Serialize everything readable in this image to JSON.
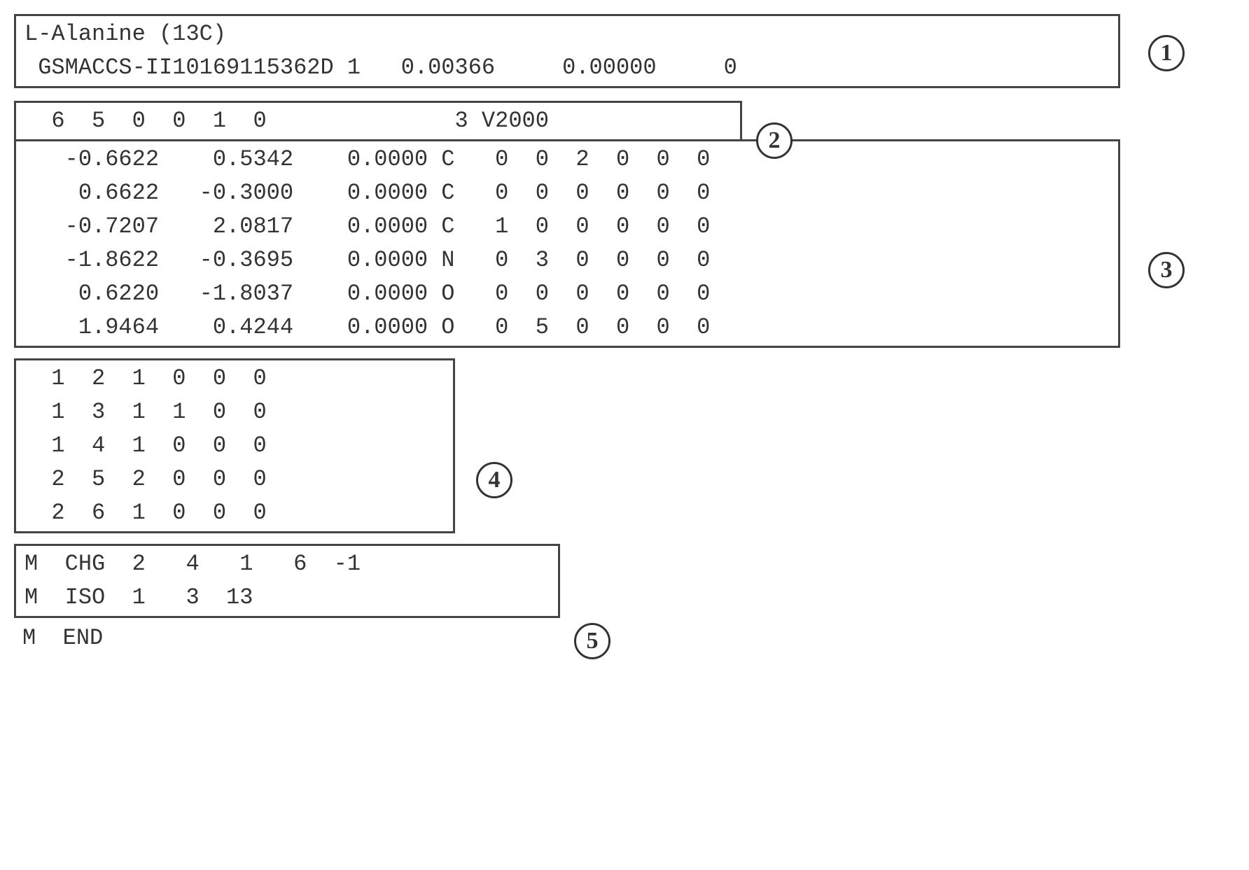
{
  "header": {
    "line1": "L-Alanine (13C)",
    "line2": " GSMACCS-II10169115362D 1   0.00366     0.00000     0"
  },
  "counts_line": "  6  5  0  0  1  0              3 V2000",
  "atoms": [
    "   -0.6622    0.5342    0.0000 C   0  0  2  0  0  0",
    "    0.6622   -0.3000    0.0000 C   0  0  0  0  0  0",
    "   -0.7207    2.0817    0.0000 C   1  0  0  0  0  0",
    "   -1.8622   -0.3695    0.0000 N   0  3  0  0  0  0",
    "    0.6220   -1.8037    0.0000 O   0  0  0  0  0  0",
    "    1.9464    0.4244    0.0000 O   0  5  0  0  0  0"
  ],
  "bonds": [
    "  1  2  1  0  0  0",
    "  1  3  1  1  0  0",
    "  1  4  1  0  0  0",
    "  2  5  2  0  0  0",
    "  2  6  1  0  0  0"
  ],
  "props": [
    "M  CHG  2   4   1   6  -1",
    "M  ISO  1   3  13"
  ],
  "end": "M  END",
  "callouts": [
    "1",
    "2",
    "3",
    "4",
    "5"
  ]
}
